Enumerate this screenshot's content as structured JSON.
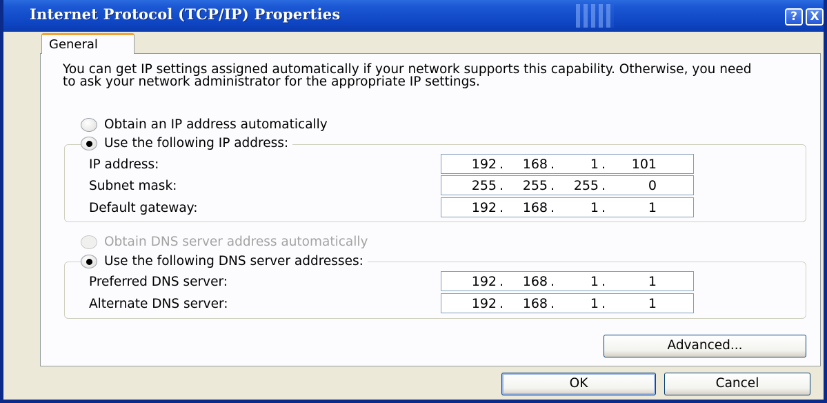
{
  "window": {
    "title": "Internet Protocol (TCP/IP) Properties",
    "help_label": "?",
    "close_label": "X"
  },
  "tabs": [
    {
      "label": "General",
      "selected": true
    }
  ],
  "intro_text": "You can get IP settings assigned automatically if your network supports this capability. Otherwise, you need to ask your network administrator for the appropriate IP settings.",
  "ip_section": {
    "auto_option": {
      "label": "Obtain an IP address automatically",
      "selected": false
    },
    "manual_option": {
      "label": "Use the following IP address:",
      "selected": true
    },
    "fields": [
      {
        "label": "IP address:",
        "octets": [
          "192",
          "168",
          "1",
          "101"
        ]
      },
      {
        "label": "Subnet mask:",
        "octets": [
          "255",
          "255",
          "255",
          "0"
        ]
      },
      {
        "label": "Default gateway:",
        "octets": [
          "192",
          "168",
          "1",
          "1"
        ]
      }
    ]
  },
  "dns_section": {
    "auto_option": {
      "label": "Obtain DNS server address automatically",
      "selected": false,
      "enabled": false
    },
    "manual_option": {
      "label": "Use the following DNS server addresses:",
      "selected": true
    },
    "fields": [
      {
        "label": "Preferred DNS server:",
        "octets": [
          "192",
          "168",
          "1",
          "1"
        ]
      },
      {
        "label": "Alternate DNS server:",
        "octets": [
          "192",
          "168",
          "1",
          "1"
        ]
      }
    ]
  },
  "buttons": {
    "advanced": "Advanced...",
    "ok": "OK",
    "cancel": "Cancel"
  },
  "colors": {
    "titlebar": "#0f46c4",
    "dialog_bg": "#ece9d8",
    "panel_bg": "#fcfcfe",
    "tab_accent": "#f1a33a"
  }
}
